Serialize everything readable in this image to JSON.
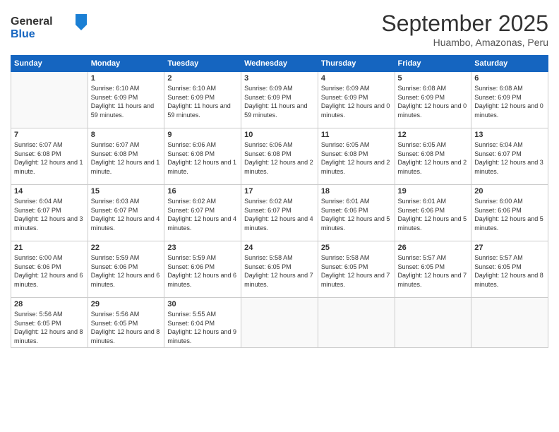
{
  "logo": {
    "general": "General",
    "blue": "Blue"
  },
  "header": {
    "month": "September 2025",
    "location": "Huambo, Amazonas, Peru"
  },
  "weekdays": [
    "Sunday",
    "Monday",
    "Tuesday",
    "Wednesday",
    "Thursday",
    "Friday",
    "Saturday"
  ],
  "weeks": [
    [
      {
        "day": "",
        "info": ""
      },
      {
        "day": "1",
        "info": "Sunrise: 6:10 AM\nSunset: 6:09 PM\nDaylight: 11 hours\nand 59 minutes."
      },
      {
        "day": "2",
        "info": "Sunrise: 6:10 AM\nSunset: 6:09 PM\nDaylight: 11 hours\nand 59 minutes."
      },
      {
        "day": "3",
        "info": "Sunrise: 6:09 AM\nSunset: 6:09 PM\nDaylight: 11 hours\nand 59 minutes."
      },
      {
        "day": "4",
        "info": "Sunrise: 6:09 AM\nSunset: 6:09 PM\nDaylight: 12 hours\nand 0 minutes."
      },
      {
        "day": "5",
        "info": "Sunrise: 6:08 AM\nSunset: 6:09 PM\nDaylight: 12 hours\nand 0 minutes."
      },
      {
        "day": "6",
        "info": "Sunrise: 6:08 AM\nSunset: 6:09 PM\nDaylight: 12 hours\nand 0 minutes."
      }
    ],
    [
      {
        "day": "7",
        "info": "Sunrise: 6:07 AM\nSunset: 6:08 PM\nDaylight: 12 hours\nand 1 minute."
      },
      {
        "day": "8",
        "info": "Sunrise: 6:07 AM\nSunset: 6:08 PM\nDaylight: 12 hours\nand 1 minute."
      },
      {
        "day": "9",
        "info": "Sunrise: 6:06 AM\nSunset: 6:08 PM\nDaylight: 12 hours\nand 1 minute."
      },
      {
        "day": "10",
        "info": "Sunrise: 6:06 AM\nSunset: 6:08 PM\nDaylight: 12 hours\nand 2 minutes."
      },
      {
        "day": "11",
        "info": "Sunrise: 6:05 AM\nSunset: 6:08 PM\nDaylight: 12 hours\nand 2 minutes."
      },
      {
        "day": "12",
        "info": "Sunrise: 6:05 AM\nSunset: 6:08 PM\nDaylight: 12 hours\nand 2 minutes."
      },
      {
        "day": "13",
        "info": "Sunrise: 6:04 AM\nSunset: 6:07 PM\nDaylight: 12 hours\nand 3 minutes."
      }
    ],
    [
      {
        "day": "14",
        "info": "Sunrise: 6:04 AM\nSunset: 6:07 PM\nDaylight: 12 hours\nand 3 minutes."
      },
      {
        "day": "15",
        "info": "Sunrise: 6:03 AM\nSunset: 6:07 PM\nDaylight: 12 hours\nand 4 minutes."
      },
      {
        "day": "16",
        "info": "Sunrise: 6:02 AM\nSunset: 6:07 PM\nDaylight: 12 hours\nand 4 minutes."
      },
      {
        "day": "17",
        "info": "Sunrise: 6:02 AM\nSunset: 6:07 PM\nDaylight: 12 hours\nand 4 minutes."
      },
      {
        "day": "18",
        "info": "Sunrise: 6:01 AM\nSunset: 6:06 PM\nDaylight: 12 hours\nand 5 minutes."
      },
      {
        "day": "19",
        "info": "Sunrise: 6:01 AM\nSunset: 6:06 PM\nDaylight: 12 hours\nand 5 minutes."
      },
      {
        "day": "20",
        "info": "Sunrise: 6:00 AM\nSunset: 6:06 PM\nDaylight: 12 hours\nand 5 minutes."
      }
    ],
    [
      {
        "day": "21",
        "info": "Sunrise: 6:00 AM\nSunset: 6:06 PM\nDaylight: 12 hours\nand 6 minutes."
      },
      {
        "day": "22",
        "info": "Sunrise: 5:59 AM\nSunset: 6:06 PM\nDaylight: 12 hours\nand 6 minutes."
      },
      {
        "day": "23",
        "info": "Sunrise: 5:59 AM\nSunset: 6:06 PM\nDaylight: 12 hours\nand 6 minutes."
      },
      {
        "day": "24",
        "info": "Sunrise: 5:58 AM\nSunset: 6:05 PM\nDaylight: 12 hours\nand 7 minutes."
      },
      {
        "day": "25",
        "info": "Sunrise: 5:58 AM\nSunset: 6:05 PM\nDaylight: 12 hours\nand 7 minutes."
      },
      {
        "day": "26",
        "info": "Sunrise: 5:57 AM\nSunset: 6:05 PM\nDaylight: 12 hours\nand 7 minutes."
      },
      {
        "day": "27",
        "info": "Sunrise: 5:57 AM\nSunset: 6:05 PM\nDaylight: 12 hours\nand 8 minutes."
      }
    ],
    [
      {
        "day": "28",
        "info": "Sunrise: 5:56 AM\nSunset: 6:05 PM\nDaylight: 12 hours\nand 8 minutes."
      },
      {
        "day": "29",
        "info": "Sunrise: 5:56 AM\nSunset: 6:05 PM\nDaylight: 12 hours\nand 8 minutes."
      },
      {
        "day": "30",
        "info": "Sunrise: 5:55 AM\nSunset: 6:04 PM\nDaylight: 12 hours\nand 9 minutes."
      },
      {
        "day": "",
        "info": ""
      },
      {
        "day": "",
        "info": ""
      },
      {
        "day": "",
        "info": ""
      },
      {
        "day": "",
        "info": ""
      }
    ]
  ]
}
